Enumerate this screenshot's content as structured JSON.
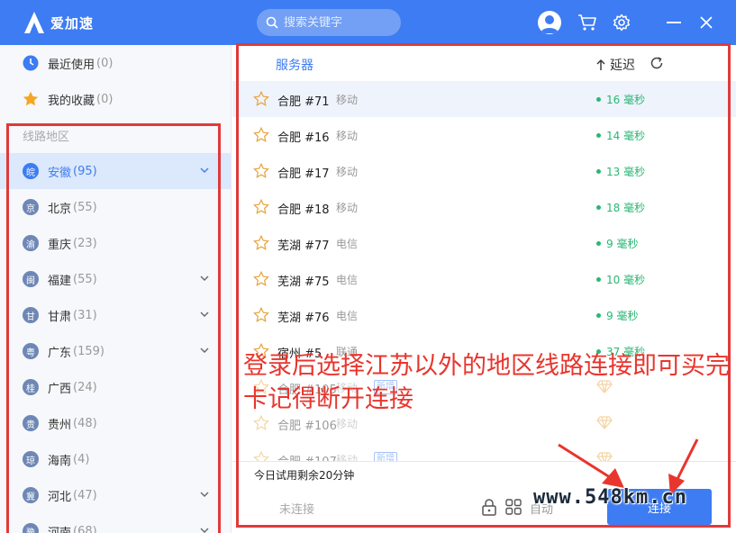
{
  "app": {
    "name": "爱加速"
  },
  "search": {
    "placeholder": "搜索关键字"
  },
  "sidebar": {
    "recent": {
      "label": "最近使用",
      "count": "(0)"
    },
    "favorites": {
      "label": "我的收藏",
      "count": "(0)"
    },
    "section_title": "线路地区",
    "regions": [
      {
        "badge": "皖",
        "name": "安徽",
        "count": "(95)",
        "expandable": true,
        "active": true
      },
      {
        "badge": "京",
        "name": "北京",
        "count": "(55)",
        "expandable": false
      },
      {
        "badge": "渝",
        "name": "重庆",
        "count": "(23)",
        "expandable": false
      },
      {
        "badge": "闽",
        "name": "福建",
        "count": "(55)",
        "expandable": true
      },
      {
        "badge": "甘",
        "name": "甘肃",
        "count": "(31)",
        "expandable": true
      },
      {
        "badge": "粤",
        "name": "广东",
        "count": "(159)",
        "expandable": true
      },
      {
        "badge": "桂",
        "name": "广西",
        "count": "(24)",
        "expandable": false
      },
      {
        "badge": "贵",
        "name": "贵州",
        "count": "(48)",
        "expandable": false
      },
      {
        "badge": "琼",
        "name": "海南",
        "count": "(4)",
        "expandable": false
      },
      {
        "badge": "冀",
        "name": "河北",
        "count": "(47)",
        "expandable": true
      },
      {
        "badge": "豫",
        "name": "河南",
        "count": "(68)",
        "expandable": true
      }
    ]
  },
  "server_panel": {
    "col_server": "服务器",
    "col_latency": "延迟",
    "rows": [
      {
        "name": "合肥 #71",
        "isp": "移动",
        "latency": "16 毫秒",
        "highlight": true
      },
      {
        "name": "合肥 #16",
        "isp": "移动",
        "latency": "14 毫秒"
      },
      {
        "name": "合肥 #17",
        "isp": "移动",
        "latency": "13 毫秒"
      },
      {
        "name": "合肥 #18",
        "isp": "移动",
        "latency": "18 毫秒"
      },
      {
        "name": "芜湖 #77",
        "isp": "电信",
        "latency": "9 毫秒"
      },
      {
        "name": "芜湖 #75",
        "isp": "电信",
        "latency": "10 毫秒"
      },
      {
        "name": "芜湖 #76",
        "isp": "电信",
        "latency": "9 毫秒"
      },
      {
        "name": "宿州 #5",
        "isp": "联通",
        "latency": "37 毫秒"
      },
      {
        "name": "合肥 #105",
        "isp": "移动",
        "new": "新增",
        "vip": true,
        "dim": true
      },
      {
        "name": "合肥 #106",
        "isp": "移动",
        "vip": true,
        "dim": true
      },
      {
        "name": "合肥 #107",
        "isp": "移动",
        "new": "新增",
        "vip": true,
        "dim": true
      }
    ],
    "trial_text": "今日试用剩余20分钟",
    "status": "未连接",
    "auto_label": "自动",
    "connect_label": "连接"
  },
  "annotation": {
    "text": "登录后选择江苏以外的地区线路连接即可买完卡记得断开连接"
  },
  "watermark": "www.548km.cn",
  "colors": {
    "brand_blue": "#3d7cf2",
    "latency_green": "#2bb673",
    "annotation_red": "#e8352d",
    "vip_gold": "#e8a33a"
  }
}
